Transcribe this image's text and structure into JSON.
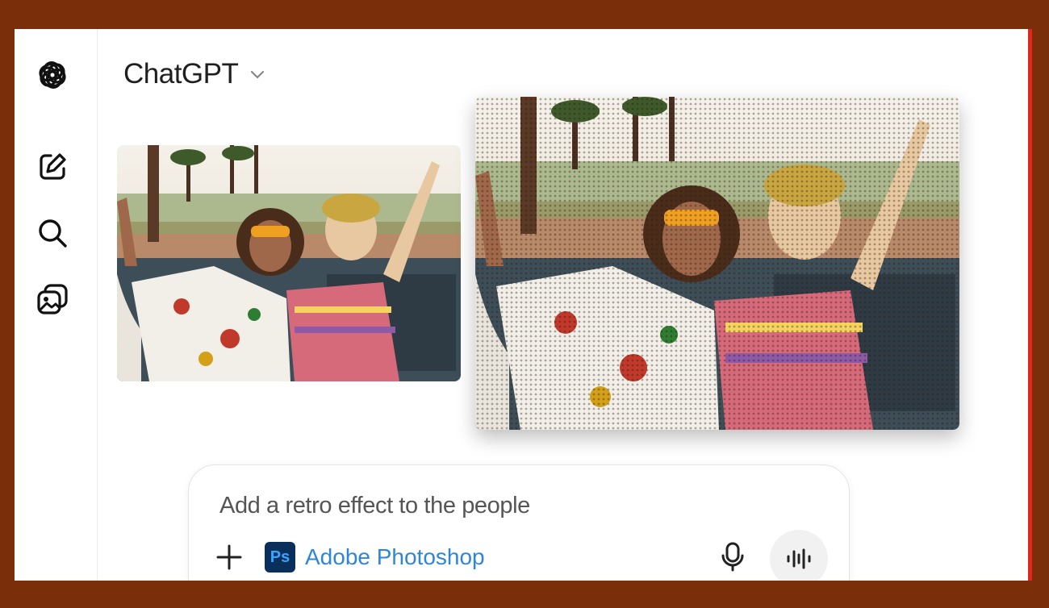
{
  "header": {
    "model_name": "ChatGPT"
  },
  "sidebar": {
    "items": [
      {
        "icon": "openai-logo-icon"
      },
      {
        "icon": "new-chat-icon"
      },
      {
        "icon": "search-icon"
      },
      {
        "icon": "images-library-icon"
      }
    ]
  },
  "images": [
    {
      "description": "original photo",
      "icon": "image"
    },
    {
      "description": "retro halftone edited photo",
      "icon": "image"
    }
  ],
  "composer": {
    "prompt": "Add a retro effect to the people",
    "tool_name": "Adobe Photoshop",
    "tool_badge": "Ps"
  },
  "colors": {
    "frame": "#7a2f0a",
    "accent": "#2f86d6",
    "ps_badge_bg": "#0b2f5b",
    "ps_badge_text": "#31a8ff"
  }
}
